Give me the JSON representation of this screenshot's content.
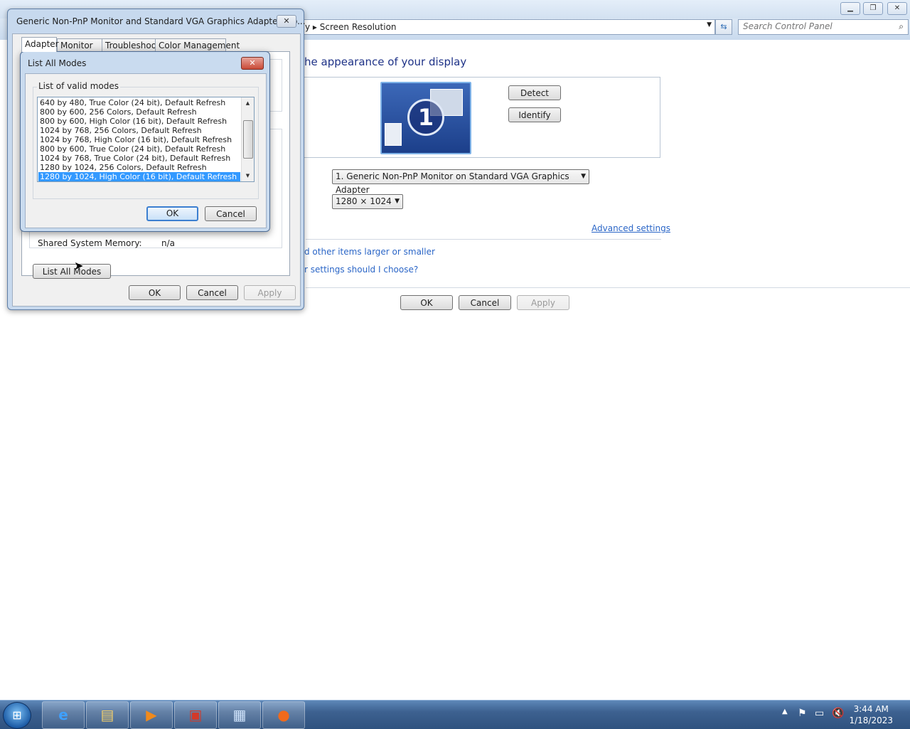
{
  "background_window": {
    "breadcrumb": "y  ▸  Screen Resolution",
    "search_placeholder": "Search Control Panel",
    "heading": "he appearance of your display",
    "monitor_number": "1",
    "detect_label": "Detect",
    "identify_label": "Identify",
    "display_select": "1. Generic Non-PnP Monitor on Standard VGA Graphics Adapter",
    "resolution_select": "1280 × 1024",
    "advanced_settings": "Advanced settings",
    "text_size_link": "d other items larger or smaller",
    "which_settings_link": "r settings should I choose?",
    "ok": "OK",
    "cancel": "Cancel",
    "apply": "Apply"
  },
  "properties_dialog": {
    "title": "Generic Non-PnP Monitor and Standard VGA Graphics Adapter Pro...",
    "tabs": [
      "Adapter",
      "Monitor",
      "Troubleshoot",
      "Color Management"
    ],
    "shared_memory_label": "Shared System Memory:",
    "shared_memory_value": "n/a",
    "list_all_modes": "List All Modes",
    "ok": "OK",
    "cancel": "Cancel",
    "apply": "Apply"
  },
  "list_modes_dialog": {
    "title": "List All Modes",
    "group_label": "List of valid modes",
    "modes": [
      "640 by 480, True Color (24 bit), Default Refresh",
      "800 by 600, 256 Colors, Default Refresh",
      "800 by 600, High Color (16 bit), Default Refresh",
      "1024 by 768, 256 Colors, Default Refresh",
      "1024 by 768, High Color (16 bit), Default Refresh",
      "800 by 600, True Color (24 bit), Default Refresh",
      "1024 by 768, True Color (24 bit), Default Refresh",
      "1280 by 1024, 256 Colors, Default Refresh",
      "1280 by 1024, High Color (16 bit), Default Refresh"
    ],
    "selected_index": 8,
    "ok": "OK",
    "cancel": "Cancel"
  },
  "taskbar": {
    "time": "3:44 AM",
    "date": "1/18/2023",
    "icons": [
      "windows-start-icon",
      "internet-explorer-icon",
      "explorer-folder-icon",
      "media-player-icon",
      "toolbox-icon",
      "control-panel-icon",
      "firefox-icon"
    ]
  },
  "colors": {
    "selection": "#3399ff",
    "link": "#2b66c7",
    "heading": "#1e3287"
  }
}
